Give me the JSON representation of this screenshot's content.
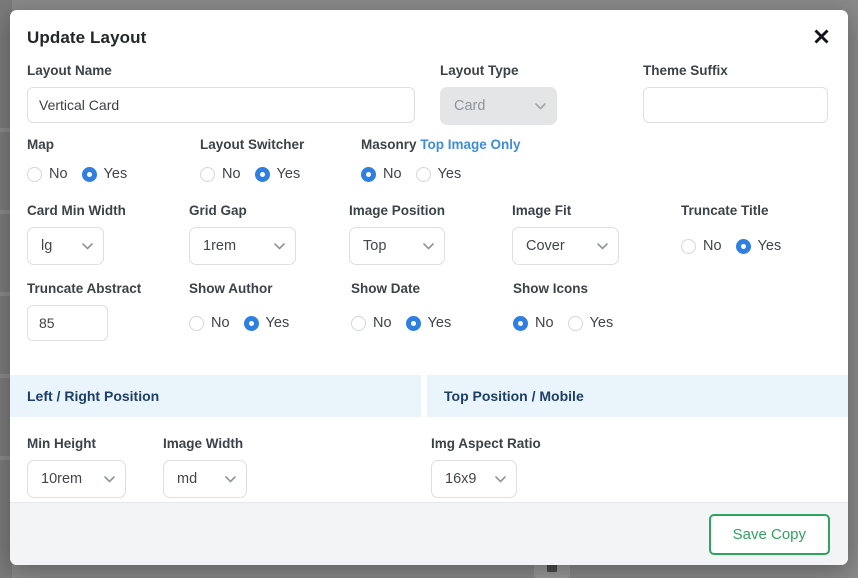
{
  "modal": {
    "title": "Update Layout",
    "close_icon": "close-icon"
  },
  "fields": {
    "layout_name": {
      "label": "Layout Name",
      "value": "Vertical Card",
      "placeholder": ""
    },
    "layout_type": {
      "label": "Layout Type",
      "value": "Card",
      "disabled": "true"
    },
    "theme_suffix": {
      "label": "Theme Suffix",
      "value": "",
      "placeholder": ""
    },
    "map": {
      "label": "Map",
      "options": [
        "No",
        "Yes"
      ],
      "value": "Yes"
    },
    "layout_switcher": {
      "label": "Layout Switcher",
      "options": [
        "No",
        "Yes"
      ],
      "value": "Yes"
    },
    "masonry": {
      "label": "Masonry",
      "link": "Top Image Only",
      "options": [
        "No",
        "Yes"
      ],
      "value": "No"
    },
    "card_min_width": {
      "label": "Card Min Width",
      "value": "lg"
    },
    "grid_gap": {
      "label": "Grid Gap",
      "value": "1rem"
    },
    "image_position": {
      "label": "Image Position",
      "value": "Top"
    },
    "image_fit": {
      "label": "Image Fit",
      "value": "Cover"
    },
    "truncate_title": {
      "label": "Truncate Title",
      "options": [
        "No",
        "Yes"
      ],
      "value": "Yes"
    },
    "truncate_abstract": {
      "label": "Truncate Abstract",
      "value": "85"
    },
    "show_author": {
      "label": "Show Author",
      "options": [
        "No",
        "Yes"
      ],
      "value": "Yes"
    },
    "show_date": {
      "label": "Show Date",
      "options": [
        "No",
        "Yes"
      ],
      "value": "Yes"
    },
    "show_icons": {
      "label": "Show Icons",
      "options": [
        "No",
        "Yes"
      ],
      "value": "No"
    },
    "min_height": {
      "label": "Min Height",
      "value": "10rem"
    },
    "image_width": {
      "label": "Image Width",
      "value": "md"
    },
    "img_aspect_ratio": {
      "label": "Img Aspect Ratio",
      "value": "16x9"
    }
  },
  "sections": {
    "left": "Left / Right Position",
    "right": "Top Position / Mobile"
  },
  "footer": {
    "save_label": "Save Copy"
  },
  "colors": {
    "radio_selected": "#2f7fe0",
    "link": "#3d8ddb",
    "section_bg": "#e9f4fb",
    "section_text": "#1d3f66",
    "save_accent": "#2fa360"
  }
}
